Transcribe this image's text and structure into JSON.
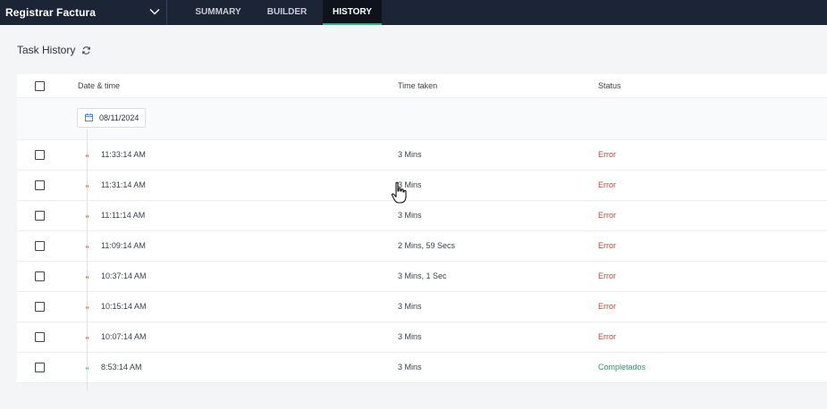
{
  "topbar": {
    "flow_name": "Registrar Factura",
    "tabs": [
      {
        "label": "SUMMARY",
        "active": false
      },
      {
        "label": "BUILDER",
        "active": false
      },
      {
        "label": "HISTORY",
        "active": true
      }
    ]
  },
  "header": {
    "title": "Task History",
    "refresh_icon": "refresh-icon"
  },
  "table": {
    "columns": [
      "Date & time",
      "Time taken",
      "Status"
    ],
    "date_group": "08/11/2024",
    "rows": [
      {
        "time": "11:33:14 AM",
        "duration": "3 Mins",
        "status": "Error"
      },
      {
        "time": "11:31:14 AM",
        "duration": "3 Mins",
        "status": "Error"
      },
      {
        "time": "11:11:14 AM",
        "duration": "3 Mins",
        "status": "Error"
      },
      {
        "time": "11:09:14 AM",
        "duration": "2 Mins, 59 Secs",
        "status": "Error"
      },
      {
        "time": "10:37:14 AM",
        "duration": "3 Mins, 1 Sec",
        "status": "Error"
      },
      {
        "time": "10:15:14 AM",
        "duration": "3 Mins",
        "status": "Error"
      },
      {
        "time": "10:07:14 AM",
        "duration": "3 Mins",
        "status": "Error"
      },
      {
        "time": "8:53:14 AM",
        "duration": "3 Mins",
        "status": "Completados"
      }
    ]
  },
  "colors": {
    "nav_bg": "#1c2536",
    "active_underline": "#2db37c",
    "error": "#d63b32",
    "success": "#1f9d6b"
  }
}
